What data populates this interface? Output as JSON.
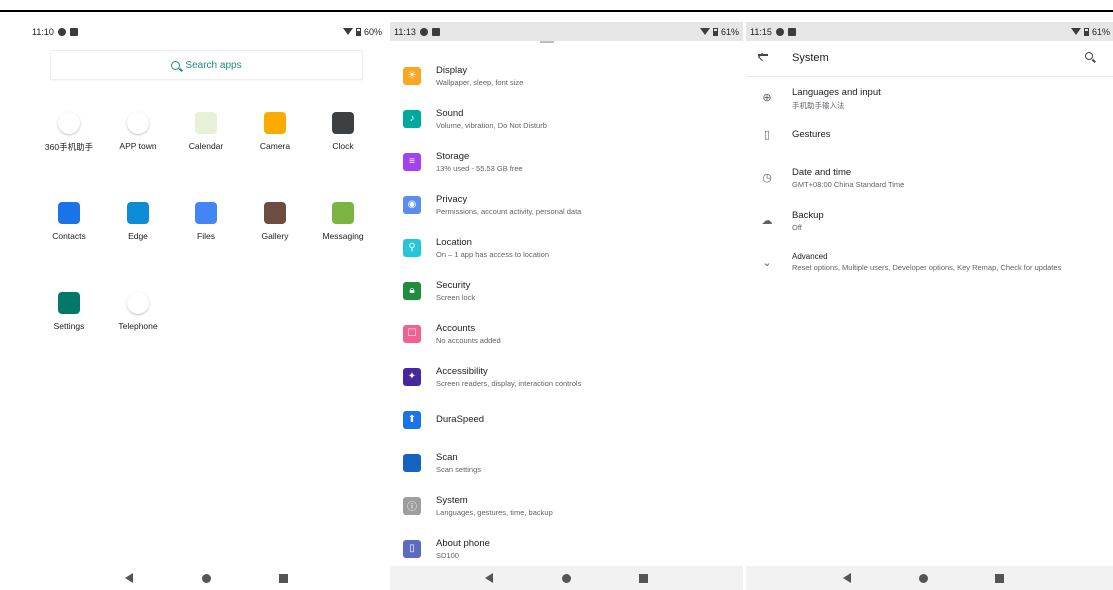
{
  "screen1": {
    "status": {
      "time": "11:10",
      "battery": "60%"
    },
    "search_label": "Search apps",
    "apps": [
      {
        "label": "360手机助手",
        "icon": "360-assistant-icon",
        "color": "#ffffff"
      },
      {
        "label": "APP town",
        "icon": "app-town-icon",
        "color": "#ffffff"
      },
      {
        "label": "Calendar",
        "icon": "calendar-icon",
        "color": "#e8f0d8"
      },
      {
        "label": "Camera",
        "icon": "camera-icon",
        "color": "#f9ab00"
      },
      {
        "label": "Clock",
        "icon": "clock-icon",
        "color": "#3c4043"
      },
      {
        "label": "Contacts",
        "icon": "contacts-icon",
        "color": "#1a73e8"
      },
      {
        "label": "Edge",
        "icon": "edge-icon",
        "color": "#0c8bd6"
      },
      {
        "label": "Files",
        "icon": "files-icon",
        "color": "#4285f4"
      },
      {
        "label": "Gallery",
        "icon": "gallery-icon",
        "color": "#6d4c41"
      },
      {
        "label": "Messaging",
        "icon": "messaging-icon",
        "color": "#7cb342"
      },
      {
        "label": "Settings",
        "icon": "settings-icon",
        "color": "#00796b"
      },
      {
        "label": "Telephone",
        "icon": "telephone-icon",
        "color": "#ffffff"
      }
    ]
  },
  "screen2": {
    "status": {
      "time": "11:13",
      "battery": "61%"
    },
    "items": [
      {
        "title": "Display",
        "subtitle": "Wallpaper, sleep, font size",
        "color": "#f9a825",
        "glyph": "☀",
        "icon": "display-icon"
      },
      {
        "title": "Sound",
        "subtitle": "Volume, vibration, Do Not Disturb",
        "color": "#00a99d",
        "glyph": "♪",
        "icon": "sound-icon"
      },
      {
        "title": "Storage",
        "subtitle": "13% used - 55.53 GB free",
        "color": "#a142f4",
        "glyph": "≡",
        "icon": "storage-icon"
      },
      {
        "title": "Privacy",
        "subtitle": "Permissions, account activity, personal data",
        "color": "#5b8def",
        "glyph": "◉",
        "icon": "privacy-icon"
      },
      {
        "title": "Location",
        "subtitle": "On – 1 app has access to location",
        "color": "#26c6da",
        "glyph": "⚲",
        "icon": "location-icon"
      },
      {
        "title": "Security",
        "subtitle": "Screen lock",
        "color": "#1e8e3e",
        "glyph": "🔒︎",
        "icon": "security-icon"
      },
      {
        "title": "Accounts",
        "subtitle": "No accounts added",
        "color": "#f06292",
        "glyph": "☐",
        "icon": "accounts-icon"
      },
      {
        "title": "Accessibility",
        "subtitle": "Screen readers, display, interaction controls",
        "color": "#4527a0",
        "glyph": "✦",
        "icon": "accessibility-icon"
      },
      {
        "title": "DuraSpeed",
        "subtitle": "",
        "color": "#1a73e8",
        "glyph": "⬆",
        "icon": "duraspeed-icon"
      },
      {
        "title": "Scan",
        "subtitle": "Scan settings",
        "color": "#1565c0",
        "glyph": "",
        "icon": "scan-icon"
      },
      {
        "title": "System",
        "subtitle": "Languages, gestures, time, backup",
        "color": "#9e9e9e",
        "glyph": "ⓘ",
        "icon": "system-icon"
      },
      {
        "title": "About phone",
        "subtitle": "SD100",
        "color": "#5c6bc0",
        "glyph": "▯",
        "icon": "about-phone-icon"
      }
    ]
  },
  "screen3": {
    "status": {
      "time": "11:15",
      "battery": "61%"
    },
    "title": "System",
    "items": [
      {
        "title": "Languages and input",
        "subtitle": "手机助手输入法",
        "glyph": "⊕",
        "icon": "globe-icon"
      },
      {
        "title": "Gestures",
        "subtitle": "",
        "glyph": "▯",
        "icon": "gestures-icon"
      },
      {
        "title": "Date and time",
        "subtitle": "GMT+08:00 China Standard Time",
        "glyph": "◷",
        "icon": "clock-icon"
      },
      {
        "title": "Backup",
        "subtitle": "Off",
        "glyph": "☁",
        "icon": "backup-icon"
      },
      {
        "title": "Advanced",
        "subtitle": "Reset options, Multiple users, Developer options, Key Remap, Check for updates",
        "glyph": "⌄",
        "icon": "chevron-down-icon"
      }
    ]
  }
}
